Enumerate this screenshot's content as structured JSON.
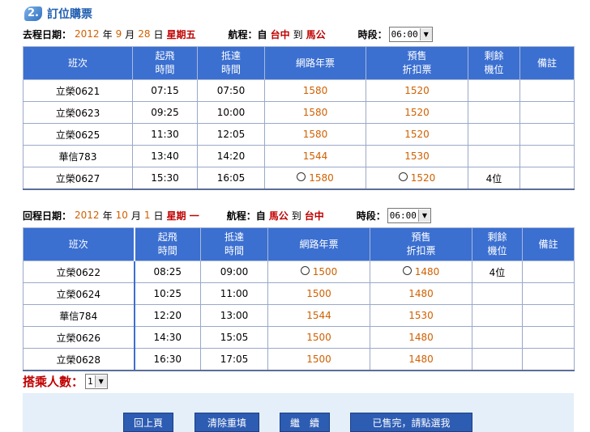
{
  "header": {
    "step": "2.",
    "title": "訂位購票"
  },
  "outbound": {
    "date_label": "去程日期：",
    "year": "2012",
    "year_unit": "年",
    "month": "9",
    "month_unit": "月",
    "day": "28",
    "day_unit": "日",
    "weekday": "星期五",
    "route_label": "航程：自",
    "from": "台中",
    "to_word": "到",
    "to": "馬公",
    "time_label": "時段：",
    "time_value": "06:00"
  },
  "return": {
    "date_label": "回程日期：",
    "year": "2012",
    "year_unit": "年",
    "month": "10",
    "month_unit": "月",
    "day": "1",
    "day_unit": "日",
    "weekday": "星期 一",
    "route_label": "航程：自",
    "from": "馬公",
    "to_word": "到",
    "to": "台中",
    "time_label": "時段：",
    "time_value": "06:00"
  },
  "table_headers": {
    "flight": "班次",
    "depart_1": "起飛",
    "depart_2": "時間",
    "arrive_1": "抵達",
    "arrive_2": "時間",
    "web": "網路年票",
    "presale_1": "預售",
    "presale_2": "折扣票",
    "seats_1": "剩餘",
    "seats_2": "機位",
    "note": "備註"
  },
  "outbound_flights": [
    {
      "flight": "立榮0621",
      "depart": "07:15",
      "arrive": "07:50",
      "web": "1580",
      "presale": "1520",
      "seats": "",
      "note": ""
    },
    {
      "flight": "立榮0623",
      "depart": "09:25",
      "arrive": "10:00",
      "web": "1580",
      "presale": "1520",
      "seats": "",
      "note": ""
    },
    {
      "flight": "立榮0625",
      "depart": "11:30",
      "arrive": "12:05",
      "web": "1580",
      "presale": "1520",
      "seats": "",
      "note": ""
    },
    {
      "flight": "華信783",
      "depart": "13:40",
      "arrive": "14:20",
      "web": "1544",
      "presale": "1530",
      "seats": "",
      "note": ""
    },
    {
      "flight": "立榮0627",
      "depart": "15:30",
      "arrive": "16:05",
      "web": "1580",
      "presale": "1520",
      "seats": "4位",
      "note": ""
    }
  ],
  "return_flights": [
    {
      "flight": "立榮0622",
      "depart": "08:25",
      "arrive": "09:00",
      "web": "1500",
      "presale": "1480",
      "seats": "4位",
      "note": ""
    },
    {
      "flight": "立榮0624",
      "depart": "10:25",
      "arrive": "11:00",
      "web": "1500",
      "presale": "1480",
      "seats": "",
      "note": ""
    },
    {
      "flight": "華信784",
      "depart": "12:20",
      "arrive": "13:00",
      "web": "1544",
      "presale": "1530",
      "seats": "",
      "note": ""
    },
    {
      "flight": "立榮0626",
      "depart": "14:30",
      "arrive": "15:05",
      "web": "1500",
      "presale": "1480",
      "seats": "",
      "note": ""
    },
    {
      "flight": "立榮0628",
      "depart": "16:30",
      "arrive": "17:05",
      "web": "1500",
      "presale": "1480",
      "seats": "",
      "note": ""
    }
  ],
  "passengers": {
    "label": "搭乘人數：",
    "value": "1"
  },
  "buttons": {
    "back": "回上頁",
    "clear": "清除重填",
    "continue": "繼　續",
    "soldout": "已售完，請點選我"
  },
  "colors": {
    "header_blue": "#3b6fd0",
    "price_orange": "#d06000",
    "date_orange": "#d06000",
    "pax_red": "#c00000",
    "panel_bg": "#e4eff9"
  }
}
